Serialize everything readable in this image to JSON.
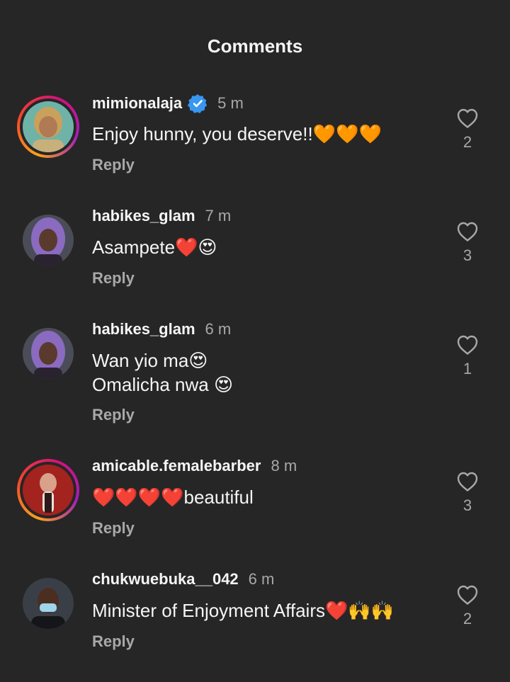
{
  "header": {
    "title": "Comments"
  },
  "comments": [
    {
      "username": "mimionalaja",
      "verified": true,
      "time": "5 m",
      "text": "Enjoy hunny, you deserve!!🧡🧡🧡",
      "reply": "Reply",
      "likes": "2",
      "story_ring": true,
      "avatar": "woman-portrait"
    },
    {
      "username": "habikes_glam",
      "verified": false,
      "time": "7 m",
      "text": "Asampete❤️😍",
      "reply": "Reply",
      "likes": "3",
      "story_ring": false,
      "avatar": "woman-purple-hair"
    },
    {
      "username": "habikes_glam",
      "verified": false,
      "time": "6 m",
      "text": "Wan yio ma😍\nOmalicha nwa 😍",
      "reply": "Reply",
      "likes": "1",
      "story_ring": false,
      "avatar": "woman-purple-hair"
    },
    {
      "username": "amicable.femalebarber",
      "verified": false,
      "time": "8 m",
      "text": "❤️❤️❤️❤️beautiful",
      "reply": "Reply",
      "likes": "3",
      "story_ring": true,
      "avatar": "woman-red-background"
    },
    {
      "username": "chukwuebuka__042",
      "verified": false,
      "time": "6 m",
      "text": "Minister of Enjoyment Affairs❤️🙌🙌",
      "reply": "Reply",
      "likes": "2",
      "story_ring": false,
      "avatar": "man-face-mask"
    }
  ],
  "colors": {
    "background": "#262626",
    "text": "#f5f5f5",
    "secondary": "#a8a8a8",
    "verified": "#3897f0"
  },
  "icons": {
    "like": "heart-outline-icon",
    "verified": "verified-badge-icon"
  }
}
